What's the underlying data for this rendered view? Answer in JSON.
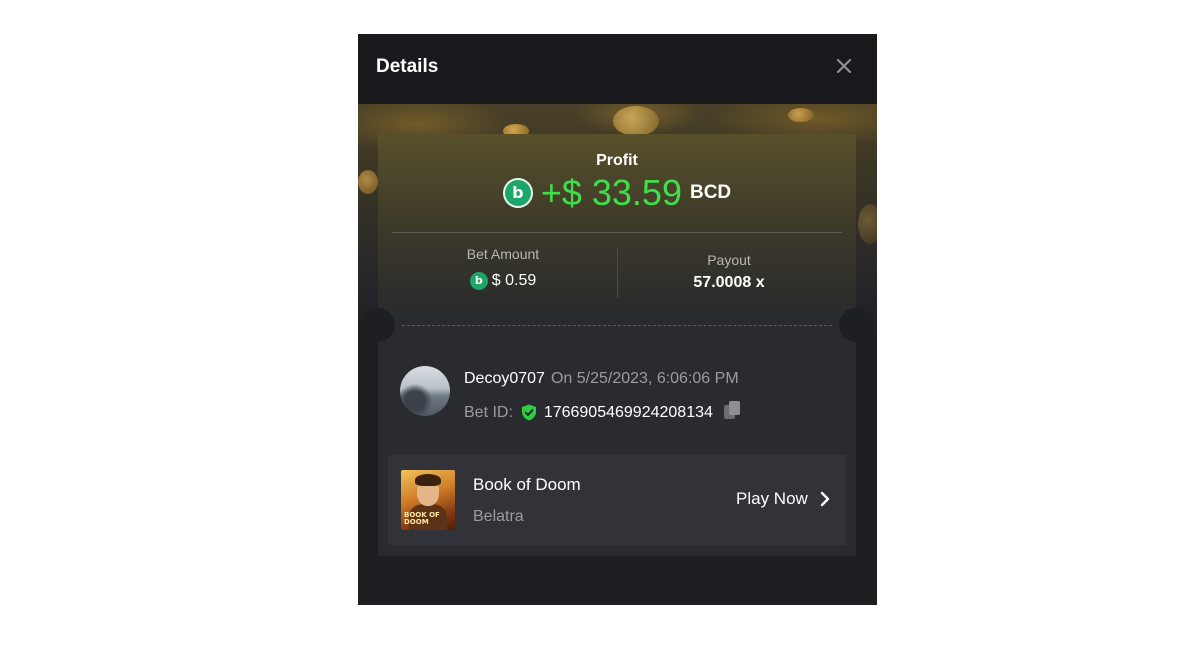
{
  "header": {
    "title": "Details"
  },
  "profit": {
    "label": "Profit",
    "icon": "bc-coin-icon",
    "value": "+$ 33.59",
    "currency": "BCD"
  },
  "bet": {
    "amount_label": "Bet Amount",
    "amount_value": "$ 0.59",
    "payout_label": "Payout",
    "payout_value": "57.0008 x"
  },
  "user": {
    "name": "Decoy0707",
    "date": "On 5/25/2023, 6:06:06 PM",
    "bet_id_label": "Bet ID:",
    "bet_id": "1766905469924208134"
  },
  "game": {
    "title": "Book of Doom",
    "provider": "Belatra",
    "thumb_text": "BOOK OF DOOM",
    "play_label": "Play Now"
  },
  "colors": {
    "profit_green": "#3ee04a",
    "coin_green": "#1ea56a",
    "modal_bg": "#1e1f22",
    "card_bg": "#2a2b30"
  }
}
